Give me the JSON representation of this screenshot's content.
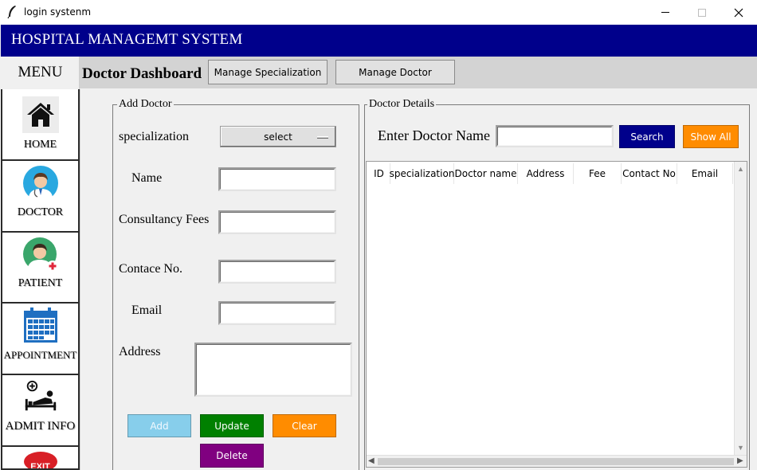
{
  "window": {
    "title": "login systenm",
    "minimize_glyph": "—",
    "maximize_glyph": "☐",
    "close_glyph": "✕"
  },
  "header": {
    "title": "HOSPITAL MANAGEMT SYSTEM"
  },
  "menu": {
    "label": "MENU"
  },
  "dashboard": {
    "title": "Doctor Dashboard",
    "manage_specialization": "Manage Specialization",
    "manage_doctor": "Manage Doctor"
  },
  "sidebar": {
    "items": [
      {
        "label": "HOME",
        "icon": "home-icon"
      },
      {
        "label": "DOCTOR",
        "icon": "doctor-icon"
      },
      {
        "label": "PATIENT",
        "icon": "patient-icon"
      },
      {
        "label": "APPOINTMENT",
        "icon": "calendar-icon"
      },
      {
        "label": "ADMIT INFO",
        "icon": "hospital-bed-icon"
      },
      {
        "label": "EXIT",
        "icon": "exit-icon"
      }
    ]
  },
  "add_doctor": {
    "title": "Add Doctor",
    "specialization_label": "specialization",
    "specialization_value": "select",
    "name_label": "Name",
    "name_value": "",
    "fees_label": "Consultancy Fees",
    "fees_value": "",
    "contact_label": "Contace No.",
    "contact_value": "",
    "email_label": "Email",
    "email_value": "",
    "address_label": "Address",
    "address_value": "",
    "buttons": {
      "add": "Add",
      "update": "Update",
      "clear": "Clear",
      "delete": "Delete"
    }
  },
  "doctor_details": {
    "title": "Doctor Details",
    "search_label": "Enter Doctor Name",
    "search_value": "",
    "search_button": "Search",
    "show_all_button": "Show All",
    "columns": [
      "ID",
      "specialization",
      "Doctor name",
      "Address",
      "Fee",
      "Contact No",
      "Email"
    ],
    "rows": []
  },
  "colors": {
    "header_bg": "#00008b",
    "search_btn": "#00008b",
    "show_all_btn": "#ff8c00",
    "add_btn": "#87ceeb",
    "update_btn": "#008000",
    "clear_btn": "#ff8c00",
    "delete_btn": "#800080"
  }
}
